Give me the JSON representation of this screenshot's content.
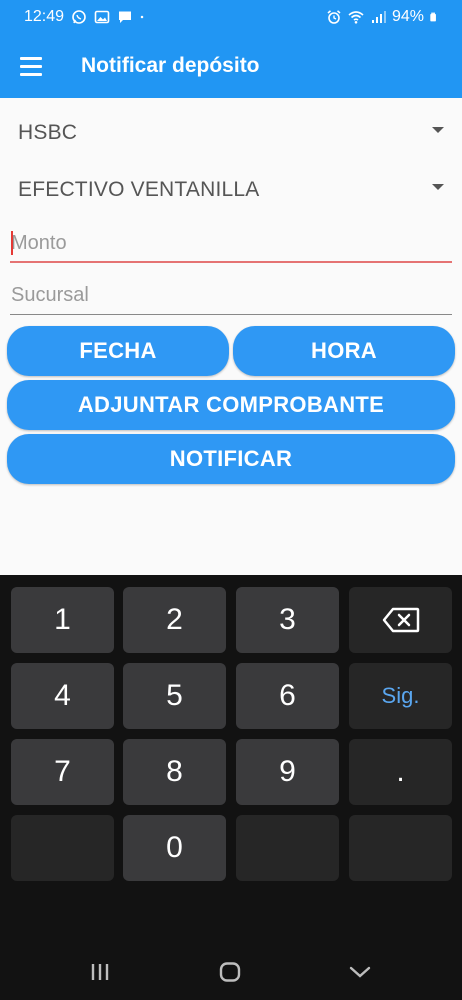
{
  "status": {
    "time": "12:49",
    "battery": "94%",
    "icons_left": [
      "whatsapp-icon",
      "image-icon",
      "message-icon",
      "dot-icon"
    ],
    "icons_right": [
      "alarm-icon",
      "wifi-icon",
      "signal-icon",
      "battery-icon"
    ]
  },
  "app_bar": {
    "title": "Notificar depósito",
    "menu_icon": "menu-icon"
  },
  "form": {
    "bank_select": "HSBC",
    "deposit_type_select": "EFECTIVO VENTANILLA",
    "amount_placeholder": "Monto",
    "amount_value": "",
    "branch_placeholder": "Sucursal",
    "branch_value": "",
    "date_button": "FECHA",
    "time_button": "HORA",
    "attach_button": "ADJUNTAR COMPROBANTE",
    "notify_button": "NOTIFICAR"
  },
  "keyboard": {
    "keys": [
      "1",
      "2",
      "3",
      "4",
      "5",
      "6",
      "7",
      "8",
      "9",
      "0",
      "."
    ],
    "next_label": "Sig.",
    "backspace_icon": "backspace-icon"
  },
  "nav": {
    "recents_icon": "recents-icon",
    "home_icon": "home-icon",
    "back_icon": "back-icon"
  },
  "colors": {
    "primary": "#2196f3",
    "button": "#2f98f4",
    "focus_underline": "#e57373",
    "keyboard_bg": "#121212",
    "key_bg": "#3a3a3c",
    "key_accent": "#5aa6ef"
  }
}
